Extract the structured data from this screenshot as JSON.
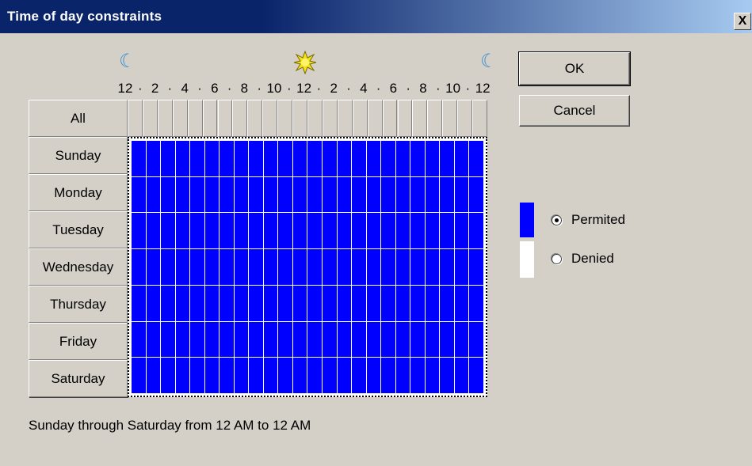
{
  "window": {
    "title": "Time of day constraints",
    "close_label": "X"
  },
  "scale": {
    "labels": [
      "12",
      "2",
      "4",
      "6",
      "8",
      "10",
      "12",
      "2",
      "4",
      "6",
      "8",
      "10",
      "12"
    ],
    "separator": "·",
    "icons": [
      "moon-icon",
      "sun-icon",
      "moon-icon"
    ]
  },
  "all_button": {
    "label": "All"
  },
  "days": [
    {
      "label": "Sunday"
    },
    {
      "label": "Monday"
    },
    {
      "label": "Tuesday"
    },
    {
      "label": "Wednesday"
    },
    {
      "label": "Thursday"
    },
    {
      "label": "Friday"
    },
    {
      "label": "Saturday"
    }
  ],
  "grid": {
    "hours_per_day": 24,
    "permitted_all": true
  },
  "buttons": {
    "ok": "OK",
    "cancel": "Cancel"
  },
  "legend": {
    "permitted": {
      "label": "Permited",
      "selected": true
    },
    "denied": {
      "label": "Denied",
      "selected": false
    }
  },
  "status": "Sunday through Saturday from 12 AM to 12 AM",
  "colors": {
    "permitted": "#0000ff",
    "denied": "#ffffff",
    "title_bar": "#0a246a"
  }
}
